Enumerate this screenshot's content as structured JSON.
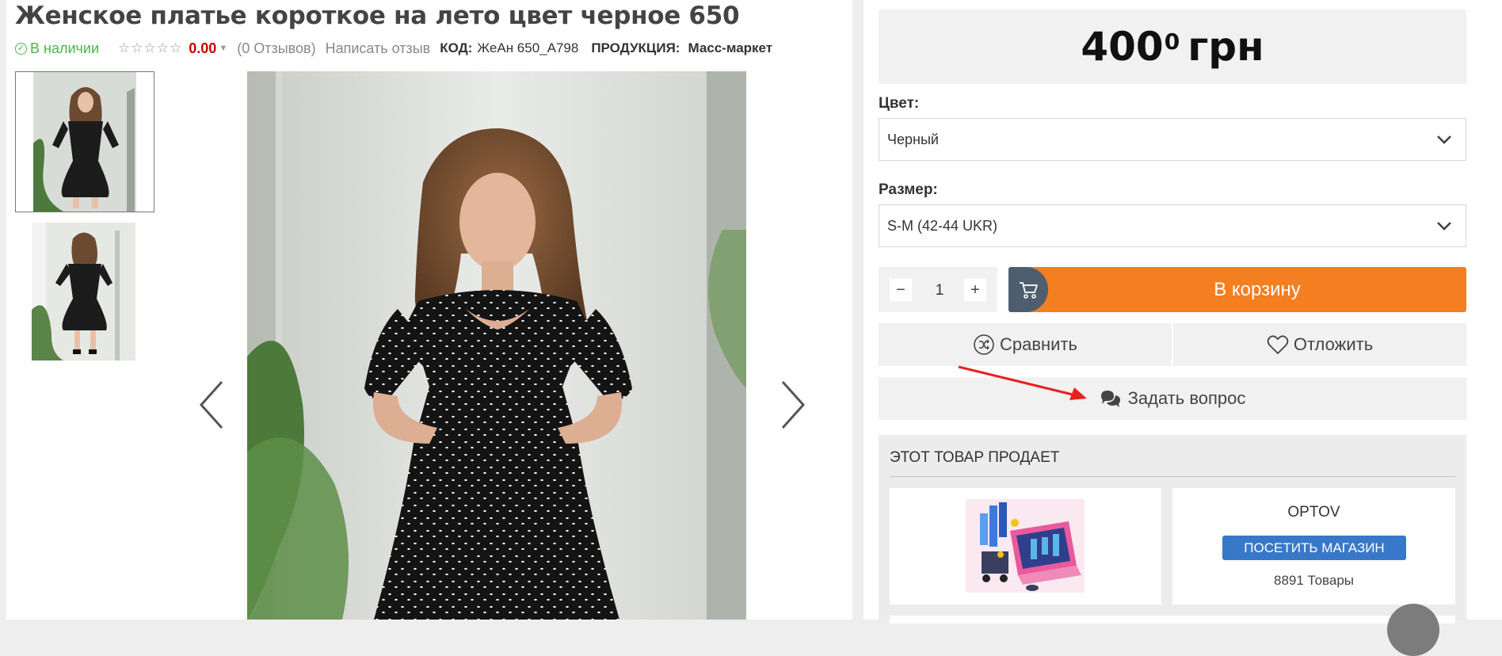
{
  "product": {
    "title": "Женское платье короткое на лето цвет черное 650",
    "stock_status": "В наличии",
    "rating_value": "0.00",
    "reviews": "(0 Отзывов)",
    "write_review": "Написать отзыв",
    "code_label": "КОД:",
    "code_value": "ЖеАн 650_А798",
    "production_label": "ПРОДУКЦИЯ:",
    "production_value": "Масс-маркет",
    "rating_stars": 0
  },
  "price": {
    "integer": "400",
    "decimal": "0",
    "currency": "грн"
  },
  "options": {
    "color_label": "Цвет:",
    "color_value": "Черный",
    "size_label": "Размер:",
    "size_value": "S-M (42-44 UKR)"
  },
  "quantity": {
    "minus": "−",
    "value": "1",
    "plus": "+"
  },
  "actions": {
    "add_to_cart": "В корзину",
    "compare": "Сравнить",
    "wishlist": "Отложить",
    "ask_question": "Задать вопрос"
  },
  "seller": {
    "section_title": "ЭТОТ ТОВАР ПРОДАЕТ",
    "shop_name": "OPTOV",
    "visit_button": "ПОСЕТИТЬ МАГАЗИН",
    "product_count": "8891 Товары"
  },
  "colors": {
    "accent_orange": "#f47f20",
    "cart_icon_bg": "#4f5e6e",
    "visit_blue": "#3878c8",
    "in_stock_green": "#4bb34b",
    "rating_red": "#cc0000",
    "annotation_arrow": "#e8201f"
  },
  "icons": {
    "stock": "check-circle-icon",
    "rating": "star-outline-icon",
    "dropdown": "chevron-down-icon",
    "cart": "shopping-cart-icon",
    "compare": "shuffle-icon",
    "wishlist": "heart-icon",
    "ask": "chat-bubbles-icon",
    "prev": "chevron-left-icon",
    "next": "chevron-right-icon"
  }
}
